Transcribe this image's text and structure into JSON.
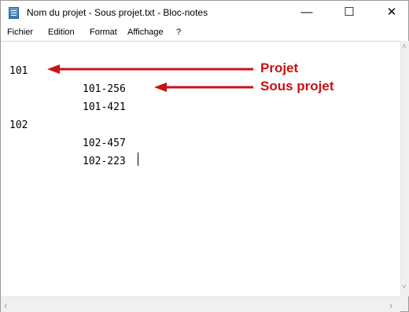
{
  "window": {
    "title": "Nom du projet - Sous projet.txt - Bloc-notes",
    "controls": {
      "minimize": "—",
      "maximize": "☐",
      "close": "✕"
    }
  },
  "menu": [
    "Fichier",
    "Edition",
    "Format",
    "Affichage",
    "?"
  ],
  "editor": {
    "lines": [
      "101",
      "101-256",
      "101-421",
      "102",
      "102-457",
      "102-223"
    ]
  },
  "annotations": {
    "projet": "Projet",
    "sous_projet": "Sous projet",
    "color": "#cc1111"
  },
  "scrollbars": {
    "up": "˄",
    "down": "˅",
    "left": "‹",
    "right": "›"
  }
}
